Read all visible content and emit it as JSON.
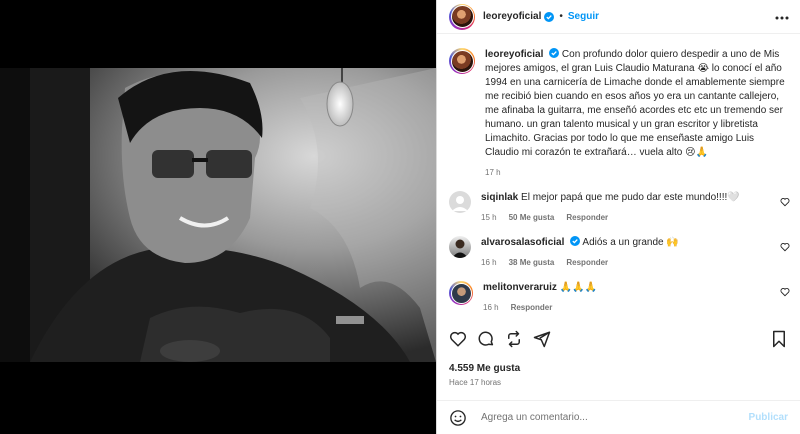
{
  "header": {
    "username": "leoreyoficial",
    "separator": "•",
    "follow_label": "Seguir"
  },
  "caption": {
    "username": "leoreyoficial",
    "text": "Con profundo dolor quiero despedir a uno de Mis mejores amigos, el gran Luis Claudio Maturana 😭 lo conocí el año 1994 en una carnicería de Limache donde el amablemente siempre me recibió bien cuando en esos años yo era un cantante callejero, me afinaba la guitarra, me enseñó acordes etc etc un tremendo ser humano. un gran talento musical y un gran escritor y libretista Limachito. Gracias por todo lo que me enseñaste amigo Luis Claudio mi corazón te extrañará… vuela alto 😢🙏",
    "time": "17 h"
  },
  "comments": [
    {
      "username": "siqinlak",
      "text": "El mejor papá que me pudo dar este mundo!!!!🤍",
      "time": "15 h",
      "likes": "50 Me gusta",
      "reply": "Responder"
    },
    {
      "username": "alvarosalasoficial",
      "text": "Adiós a un grande 🙌",
      "time": "16 h",
      "likes": "38 Me gusta",
      "reply": "Responder"
    },
    {
      "username": "melitonveraruiz",
      "text": "🙏🙏🙏",
      "time": "16 h",
      "likes": "",
      "reply": "Responder"
    }
  ],
  "likes": "4.559 Me gusta",
  "posted": "Hace 17 horas",
  "comment_bar": {
    "placeholder": "Agrega un comentario...",
    "post_label": "Publicar"
  },
  "colors": {
    "link": "#0095f6",
    "muted": "#737373",
    "verified": "#0095f6",
    "post_disabled": "#b2dffc"
  },
  "icons": [
    "more-icon",
    "verified-icon",
    "heart-icon",
    "comment-icon",
    "share-icon",
    "send-icon",
    "bookmark-icon",
    "emoji-icon"
  ]
}
